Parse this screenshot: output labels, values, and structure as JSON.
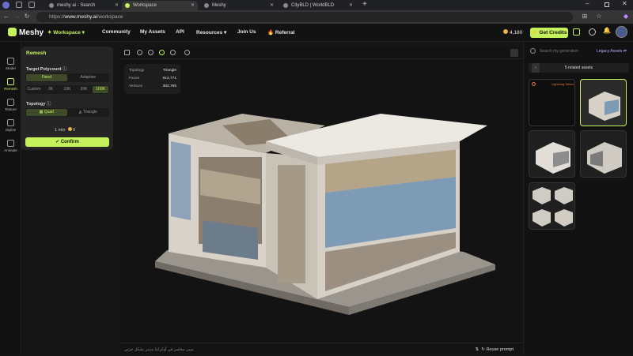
{
  "browser": {
    "tabs": [
      {
        "title": "meshy ai - Search"
      },
      {
        "title": "Workspace",
        "active": true
      },
      {
        "title": "Meshy"
      },
      {
        "title": "CityBLD | WorldBLD"
      }
    ],
    "url_prefix": "https://",
    "url_domain": "www.meshy.ai",
    "url_path": "/workspace"
  },
  "header": {
    "brand": "Meshy",
    "workspace": "Workspace",
    "menu": [
      "Community",
      "My Assets",
      "API",
      "Resources",
      "Join Us",
      "Referral"
    ],
    "credits": "4,180",
    "get_credits": "Get Credits"
  },
  "rail": [
    "Model",
    "Remesh",
    "Texture",
    "Stylize",
    "Animate"
  ],
  "remesh": {
    "title": "Remesh",
    "target_label": "Target Polycount",
    "modes": [
      "Fixed",
      "Adaptive"
    ],
    "counts": [
      "Custom",
      "3K",
      "10K",
      "30K",
      "100K"
    ],
    "topology_label": "Topology",
    "topologies": [
      "Quad",
      "Triangle"
    ],
    "eta": "1 min",
    "cost": "0",
    "confirm": "Confirm"
  },
  "stats": {
    "topology_label": "Topology",
    "topology": "Triangle",
    "faces_label": "Faces",
    "faces": "614,771",
    "vertices_label": "Vertices",
    "vertices": "302,765"
  },
  "prompt": {
    "placeholder": "مبنى معاصر في أوكرانيا مدمر بشكل جزئي",
    "reuse": "Reuse prompt"
  },
  "right": {
    "search_placeholder": "Search my generation",
    "legacy": "Legacy Assets",
    "related": "5 related assets",
    "first_thumb": "Lightning Select"
  },
  "colors": {
    "accent": "#c5f25a",
    "bg": "#151515"
  }
}
